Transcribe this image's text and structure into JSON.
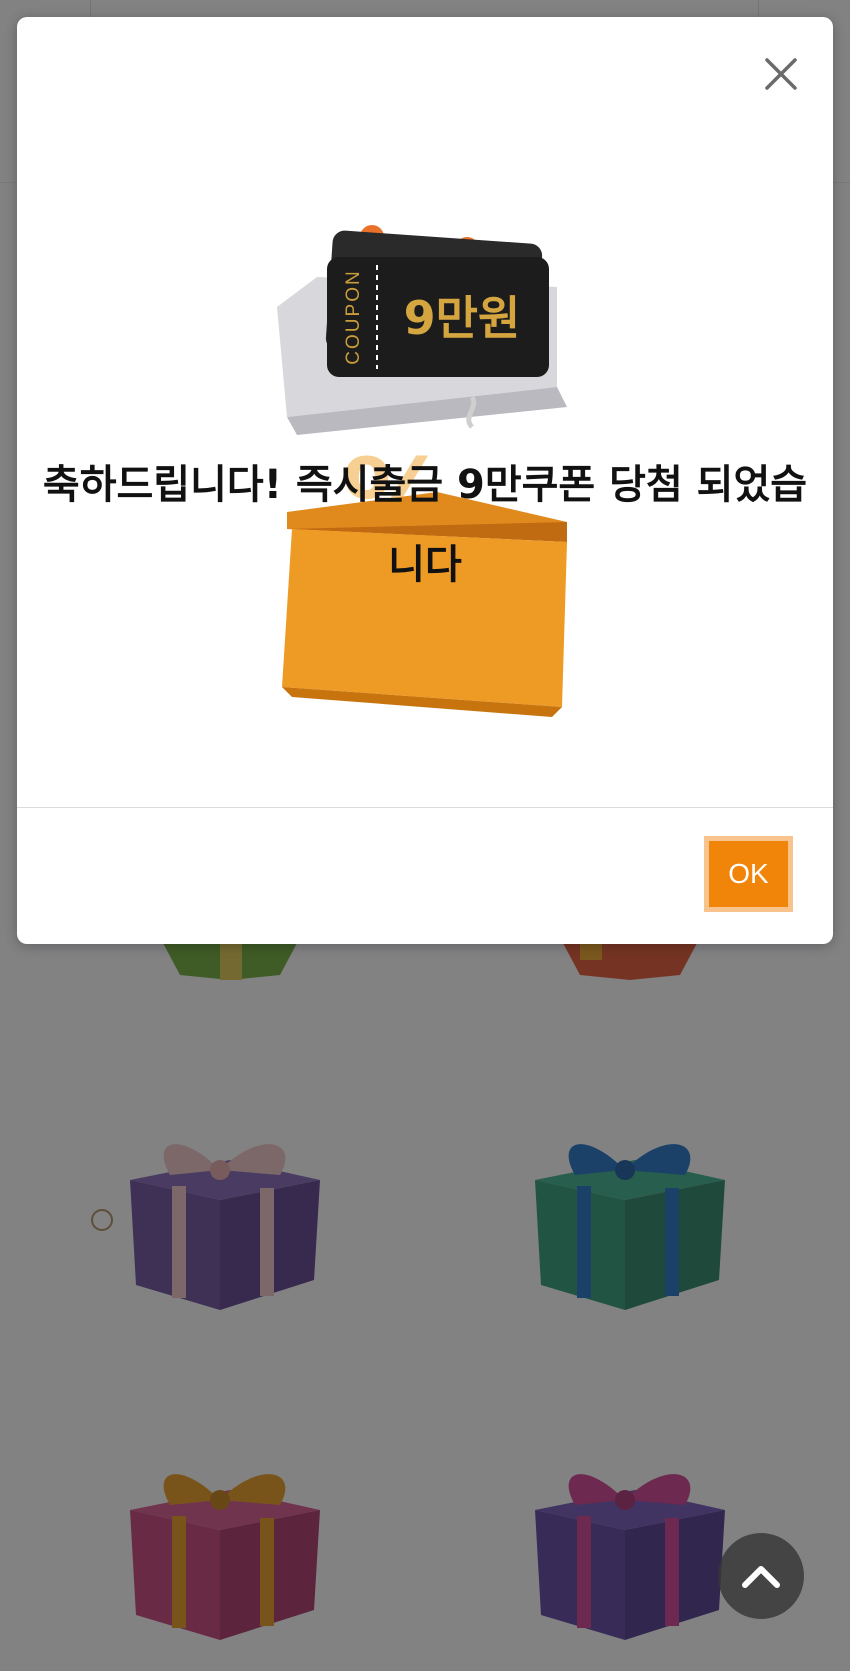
{
  "modal": {
    "message": "축하드립니다! 즉시출금 9만쿠폰 당첨 되었습니다",
    "ok_label": "OK",
    "close_icon": "close-icon",
    "accent_color": "#f0850a"
  },
  "illustration": {
    "coupon_label": "COUPON",
    "coupon_amount": "9만원",
    "percent_mark": "%"
  },
  "gifts": [
    {
      "name": "gift-purple-pink-ribbon",
      "box": "#6a4a9c",
      "ribbon": "#f2c6c6"
    },
    {
      "name": "gift-green-blue-ribbon",
      "box": "#2a9a72",
      "ribbon": "#1b6fc4"
    },
    {
      "name": "gift-pink-orange-ribbon",
      "box": "#c83c78",
      "ribbon": "#e89a1a"
    },
    {
      "name": "gift-purple-magenta-ribbon",
      "box": "#5c3fa0",
      "ribbon": "#d03a8c"
    }
  ],
  "scroll_top_icon": "chevron-up-icon"
}
